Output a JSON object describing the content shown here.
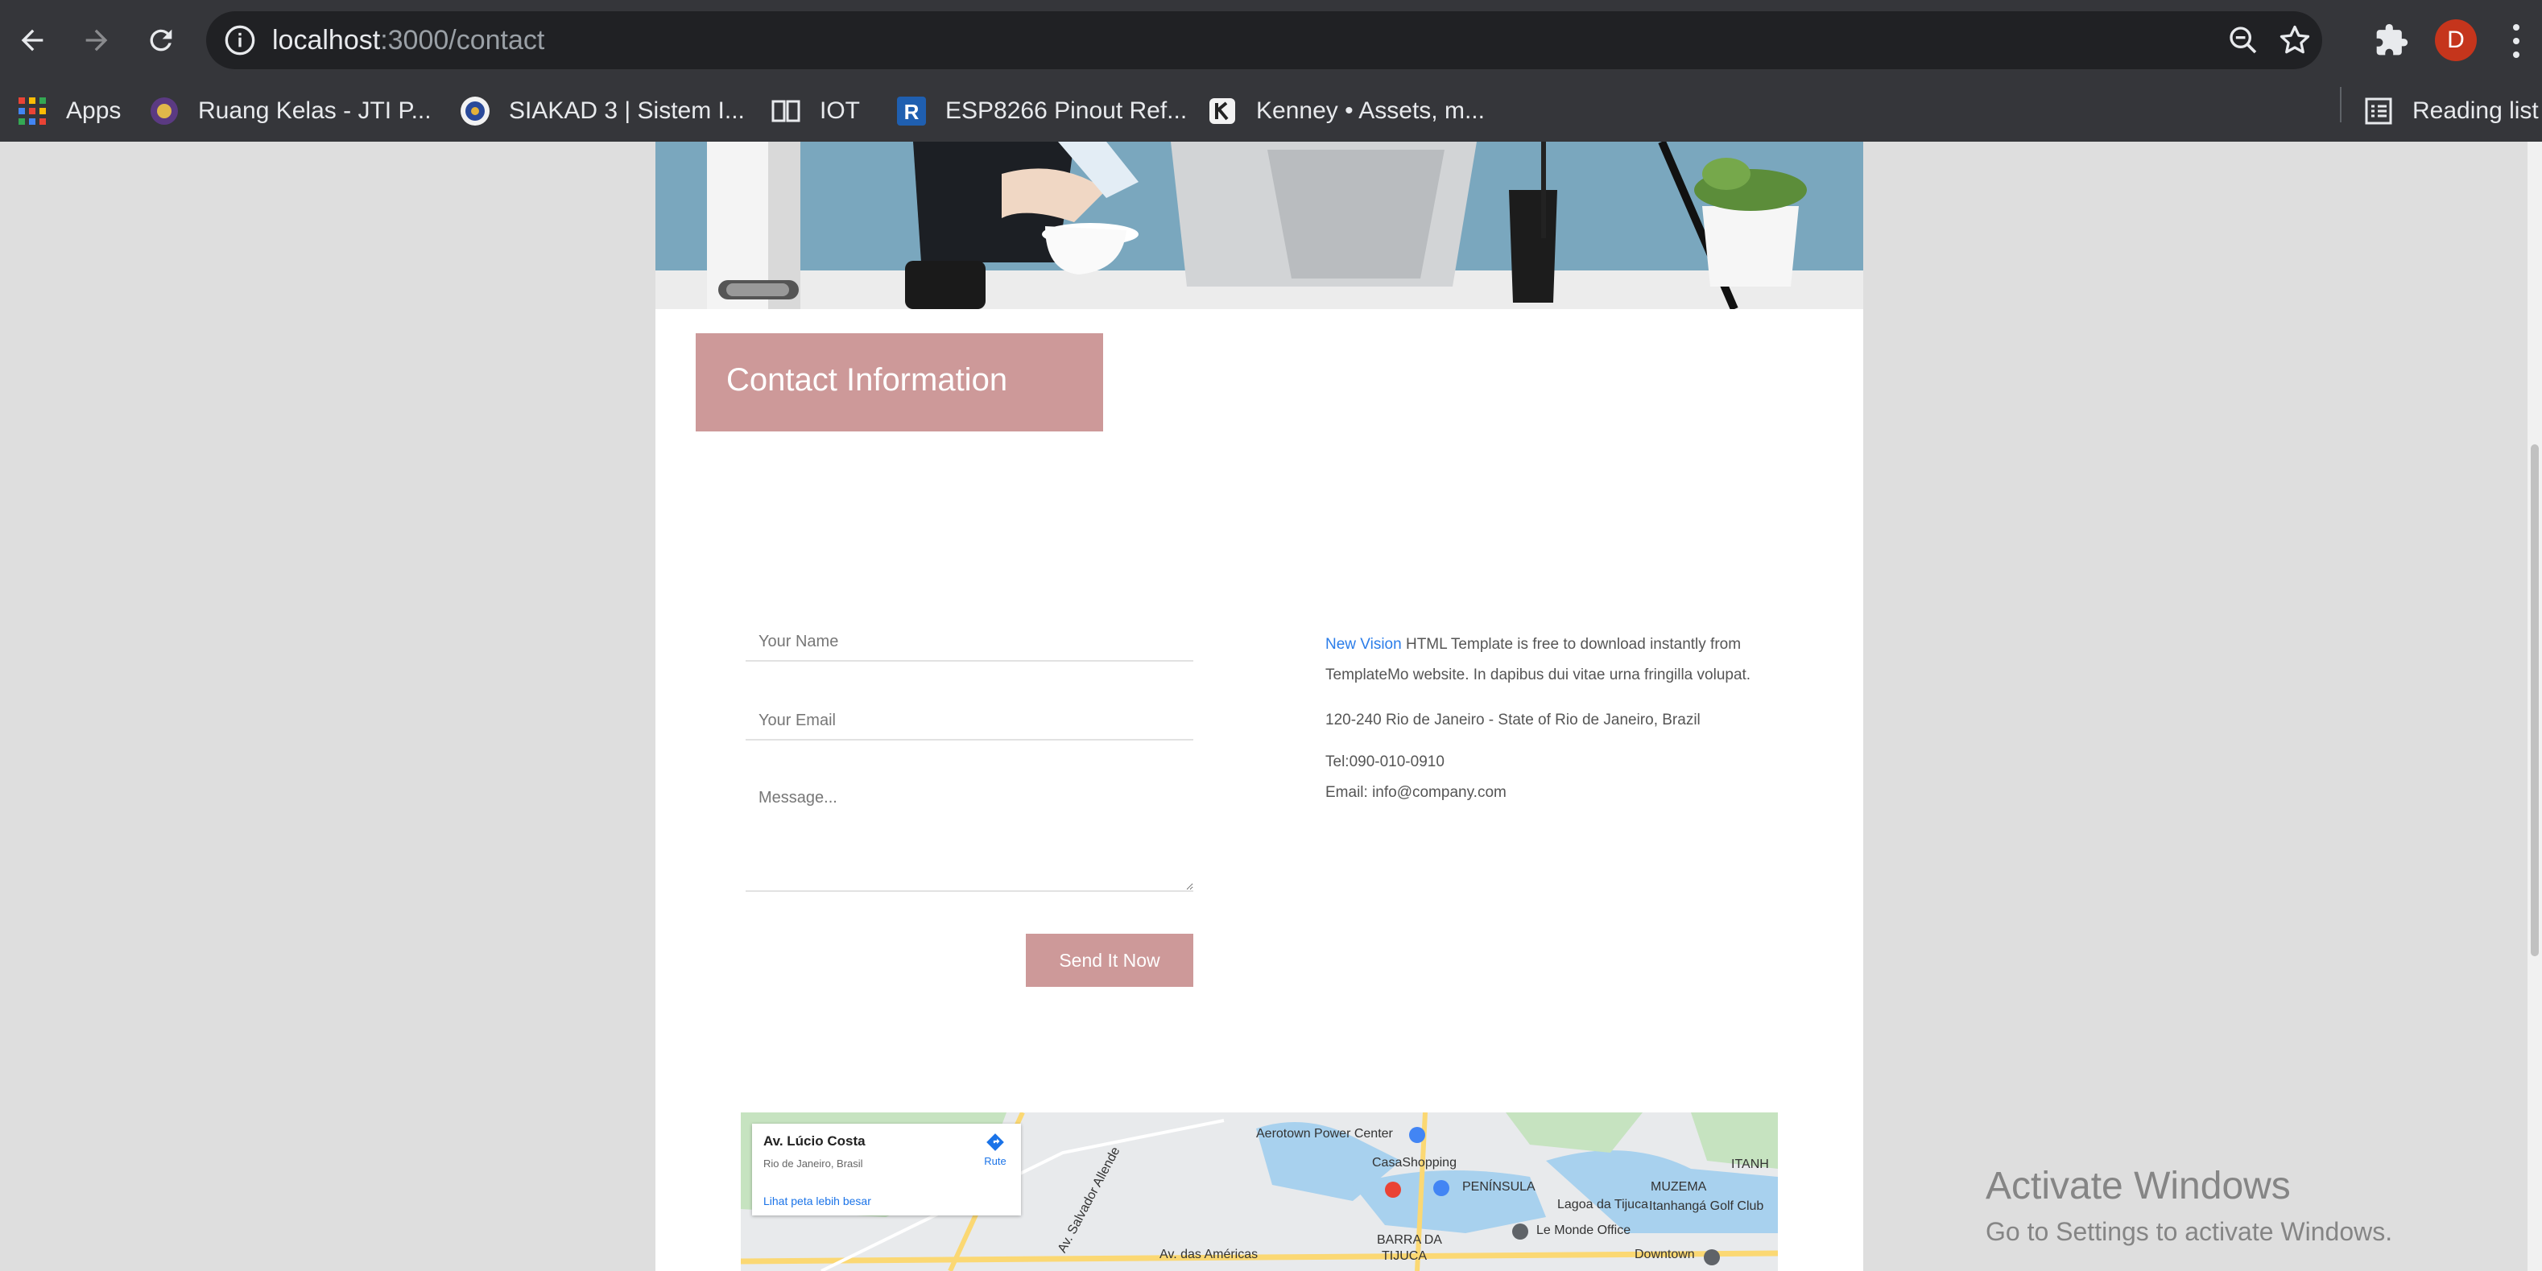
{
  "browser": {
    "url_host": "localhost",
    "url_path": ":3000/contact",
    "profile_initial": "D",
    "bookmarks": [
      {
        "label": "Apps",
        "icon": "apps-grid-icon"
      },
      {
        "label": "Ruang Kelas - JTI P...",
        "icon": "jti-logo-icon"
      },
      {
        "label": "SIAKAD 3 | Sistem I...",
        "icon": "siakad-logo-icon"
      },
      {
        "label": "IOT",
        "icon": "iot-book-icon"
      },
      {
        "label": "ESP8266 Pinout Ref...",
        "icon": "r-logo-icon"
      },
      {
        "label": "Kenney • Assets, m...",
        "icon": "kenney-logo-icon"
      }
    ],
    "reading_list": "Reading list"
  },
  "contact": {
    "heading": "Contact Information",
    "form": {
      "name_placeholder": "Your Name",
      "email_placeholder": "Your Email",
      "message_placeholder": "Message...",
      "send_label": "Send It Now"
    },
    "info": {
      "brand_link": "New Vision",
      "description": " HTML Template is free to download instantly from TemplateMo website. In dapibus dui vitae urna fringilla volupat.",
      "address": "120-240 Rio de Janeiro - State of Rio de Janeiro, Brazil",
      "tel": "Tel:090-010-0910",
      "email": "Email: info@company.com"
    }
  },
  "map": {
    "place_title": "Av. Lúcio Costa",
    "place_subtitle": "Rio de Janeiro, Brasil",
    "larger_map_link": "Lihat peta lebih besar",
    "route_label": "Rute",
    "labels": [
      "Aerotown Power Center",
      "CasaShopping",
      "PENÍNSULA",
      "MUZEMA",
      "ITANH",
      "Lagoa da Tijuca",
      "Itanhangá Golf Club",
      "Le Monde Office",
      "BARRA DA",
      "TIJUCA",
      "Downtown",
      "Av. das Américas",
      "Av. Salvador Allende"
    ]
  },
  "windows": {
    "activate_title": "Activate Windows",
    "activate_sub": "Go to Settings to activate Windows."
  },
  "colors": {
    "accent": "#cd9999",
    "link": "#2b7de9",
    "chrome_bg": "#35363a"
  }
}
